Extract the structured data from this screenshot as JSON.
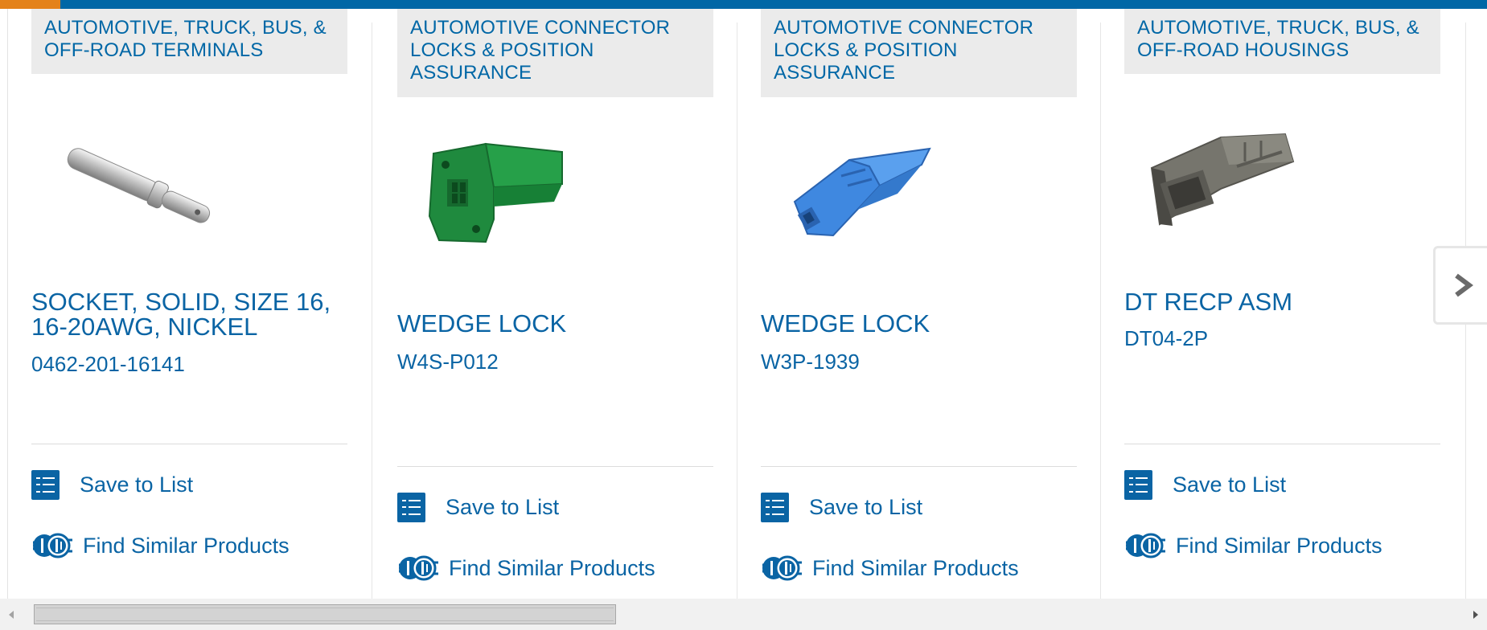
{
  "colors": {
    "brand_blue": "#0067a6",
    "accent_orange": "#e4821a",
    "category_bg": "#ebebeb"
  },
  "cards": [
    {
      "category": "AUTOMOTIVE, TRUCK, BUS, & OFF-ROAD TERMINALS",
      "title": "SOCKET, SOLID, SIZE 16, 16-20AWG, NICKEL",
      "part_number": "0462-201-16141",
      "image": "socket-terminal-image",
      "save_label": "Save to List",
      "find_label": "Find Similar Products"
    },
    {
      "category": "AUTOMOTIVE CONNECTOR LOCKS & POSITION ASSURANCE",
      "title": "WEDGE LOCK",
      "part_number": "W4S-P012",
      "image": "green-wedge-lock-image",
      "save_label": "Save to List",
      "find_label": "Find Similar Products"
    },
    {
      "category": "AUTOMOTIVE CONNECTOR LOCKS & POSITION ASSURANCE",
      "title": "WEDGE LOCK",
      "part_number": "W3P-1939",
      "image": "blue-wedge-lock-image",
      "save_label": "Save to List",
      "find_label": "Find Similar Products"
    },
    {
      "category": "AUTOMOTIVE, TRUCK, BUS, & OFF-ROAD HOUSINGS",
      "title": "DT RECP ASM",
      "part_number": "DT04-2P",
      "image": "gray-receptacle-housing-image",
      "save_label": "Save to List",
      "find_label": "Find Similar Products"
    }
  ],
  "icons": {
    "save": "checklist-icon",
    "find": "gears-icon",
    "next": "chevron-right-icon",
    "scroll_left": "scroll-left-arrow-icon",
    "scroll_right": "scroll-right-arrow-icon"
  },
  "scrollbar": {
    "thumb_fraction": 0.41,
    "position_fraction": 0.0
  }
}
